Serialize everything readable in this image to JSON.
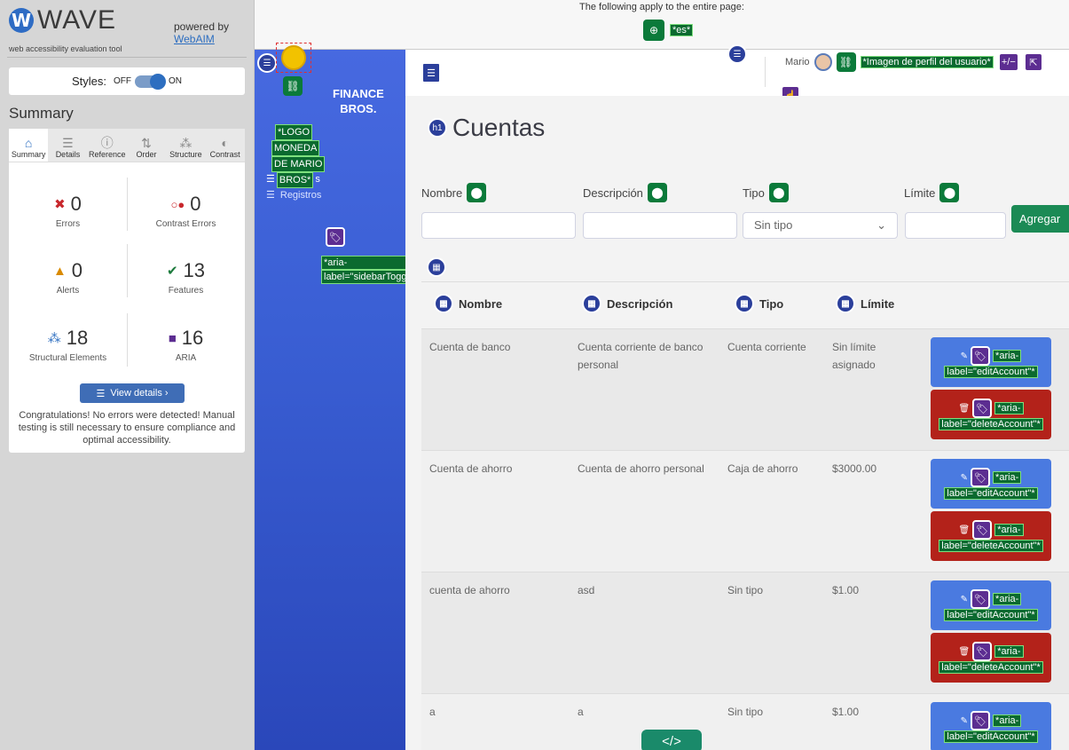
{
  "wave": {
    "logo_word": "WAVE",
    "powered_by": "powered by",
    "webaim": "WebAIM",
    "subtitle": "web accessibility evaluation tool",
    "styles_label": "Styles:",
    "styles_off": "OFF",
    "styles_on": "ON",
    "summary_title": "Summary",
    "tabs": [
      {
        "label": "Summary",
        "icon": "⌂"
      },
      {
        "label": "Details",
        "icon": "☰"
      },
      {
        "label": "Reference",
        "icon": "ⓘ"
      },
      {
        "label": "Order",
        "icon": "⇅"
      },
      {
        "label": "Structure",
        "icon": "⁂"
      },
      {
        "label": "Contrast",
        "icon": "◐"
      }
    ],
    "stats": {
      "errors": {
        "value": "0",
        "label": "Errors"
      },
      "contrast": {
        "value": "0",
        "label": "Contrast Errors"
      },
      "alerts": {
        "value": "0",
        "label": "Alerts"
      },
      "features": {
        "value": "13",
        "label": "Features"
      },
      "structural": {
        "value": "18",
        "label": "Structural Elements"
      },
      "aria": {
        "value": "16",
        "label": "ARIA"
      }
    },
    "view_details": "View details ›",
    "congrats": "Congratulations! No errors were detected! Manual testing is still necessary to ensure compliance and optimal accessibility."
  },
  "pagebar": {
    "message": "The following apply to the entire page:",
    "lang_label": "*es*"
  },
  "sidebar": {
    "brand_line1": "FINANCE",
    "brand_line2": "BROS.",
    "logo_label_lines": [
      "*LOGO",
      "MONEDA",
      "DE MARIO",
      "BROS*"
    ],
    "logo_suffix": "s",
    "nav_item": "Registros",
    "aria_label_lines": [
      "*aria-",
      "label=\"sidebarTogg"
    ]
  },
  "topbar": {
    "user_name": "Mario",
    "profile_label": "*Imagen de perfil del usuario*",
    "plus_minus": "+/−"
  },
  "main": {
    "title": "Cuentas",
    "h1_badge": "h1",
    "fields": {
      "nombre": "Nombre",
      "descripcion": "Descripción",
      "tipo": "Tipo",
      "limite": "Límite"
    },
    "tipo_select_value": "Sin tipo",
    "add_button": "Agregar",
    "table_headers": [
      "Nombre",
      "Descripción",
      "Tipo",
      "Límite"
    ],
    "rows": [
      {
        "nombre": "Cuenta de banco",
        "descripcion": "Cuenta corriente de banco personal",
        "tipo": "Cuenta corriente",
        "limite": "Sin límite asignado"
      },
      {
        "nombre": "Cuenta de ahorro",
        "descripcion": "Cuenta de ahorro personal",
        "tipo": "Caja de ahorro",
        "limite": "$3000.00"
      },
      {
        "nombre": "cuenta de ahorro",
        "descripcion": "asd",
        "tipo": "Sin tipo",
        "limite": "$1.00"
      },
      {
        "nombre": "a",
        "descripcion": "a",
        "tipo": "Sin tipo",
        "limite": "$1.00"
      }
    ],
    "edit_aria_lines": [
      "*aria-",
      "label=\"editAccount\"*"
    ],
    "delete_aria_lines": [
      "*aria-",
      "label=\"deleteAccount\"*"
    ]
  },
  "code_badge": "</>",
  "colors": {
    "wave_blue": "#2d6ec0",
    "sidebar_blue": "#4769e0",
    "wave_green_label": "#0b6a2f",
    "aria_purple": "#5c2d91",
    "edit_blue": "#4a7ae0",
    "delete_red": "#b3221a",
    "add_green": "#1b8a55"
  }
}
